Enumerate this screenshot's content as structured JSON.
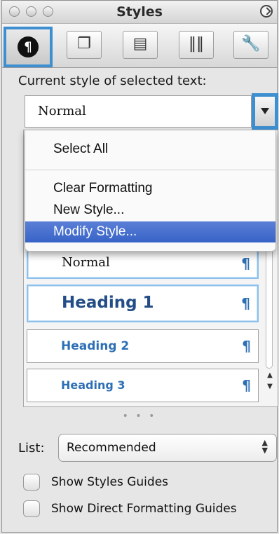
{
  "window": {
    "title": "Styles"
  },
  "tabs": [
    {
      "icon": "paragraph-styles-icon",
      "active": true
    },
    {
      "icon": "copy-pages-icon",
      "active": false
    },
    {
      "icon": "image-gallery-icon",
      "active": false
    },
    {
      "icon": "columns-icon",
      "active": false
    },
    {
      "icon": "wrench-icon",
      "active": false
    }
  ],
  "current_style": {
    "label": "Current style of selected text:",
    "value": "Normal"
  },
  "menu": {
    "items": [
      {
        "label": "Select All",
        "highlighted": false
      },
      {
        "label": "Clear Formatting",
        "highlighted": false
      },
      {
        "label": "New Style...",
        "highlighted": false
      },
      {
        "label": "Modify Style...",
        "highlighted": true
      }
    ]
  },
  "styles": [
    {
      "name": "Normal",
      "mark": "¶",
      "selected": true
    },
    {
      "name": "Heading 1",
      "mark": "¶",
      "selected": true
    },
    {
      "name": "Heading 2",
      "mark": "¶",
      "selected": false
    },
    {
      "name": "Heading 3",
      "mark": "¶",
      "selected": false
    }
  ],
  "list": {
    "label": "List:",
    "value": "Recommended"
  },
  "checkboxes": [
    {
      "label": "Show Styles Guides",
      "checked": false
    },
    {
      "label": "Show Direct Formatting Guides",
      "checked": false
    }
  ],
  "colors": {
    "accent": "#3e8fd0",
    "heading": "#2d6fb5",
    "menu_highlight": "#4a72cf"
  }
}
